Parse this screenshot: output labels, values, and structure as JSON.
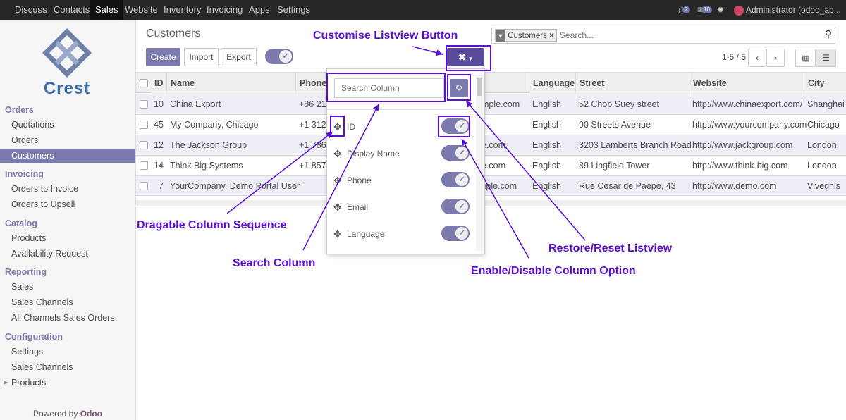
{
  "topnav": {
    "items": [
      "Discuss",
      "Contacts",
      "Sales",
      "Website",
      "Inventory",
      "Invoicing",
      "Apps",
      "Settings"
    ],
    "active": "Sales",
    "chat_badge": "2",
    "msg_badge": "10",
    "user": "Administrator (odoo_ap..."
  },
  "sidebar": {
    "logo_text": "Crest",
    "sections": [
      {
        "title": "Orders",
        "items": [
          "Quotations",
          "Orders",
          "Customers"
        ]
      },
      {
        "title": "Invoicing",
        "items": [
          "Orders to Invoice",
          "Orders to Upsell"
        ]
      },
      {
        "title": "Catalog",
        "items": [
          "Products",
          "Availability Request"
        ]
      },
      {
        "title": "Reporting",
        "items": [
          "Sales",
          "Sales Channels",
          "All Channels Sales Orders"
        ]
      },
      {
        "title": "Configuration",
        "items": [
          "Settings",
          "Sales Channels",
          "Products"
        ]
      }
    ],
    "active_item": "Customers",
    "powered_by": "Powered by",
    "powered_brand": "Odoo"
  },
  "main": {
    "breadcrumb": "Customers",
    "buttons": {
      "create": "Create",
      "import": "Import",
      "export": "Export"
    },
    "search": {
      "facet": "Customers",
      "placeholder": "Search..."
    },
    "pager": "1-5 / 5",
    "columns": [
      "ID",
      "Name",
      "Phone",
      "Language",
      "Street",
      "Website",
      "City"
    ],
    "rows": [
      {
        "id": "10",
        "name": "China Export",
        "phone": "+86 21",
        "email_part": "mple.com",
        "lang": "English",
        "street": "52 Chop Suey street",
        "website": "http://www.chinaexport.com/",
        "city": "Shanghai"
      },
      {
        "id": "45",
        "name": "My Company, Chicago",
        "phone": "+1 312",
        "email_part": "",
        "lang": "English",
        "street": "90 Streets Avenue",
        "website": "http://www.yourcompany.com",
        "city": "Chicago"
      },
      {
        "id": "12",
        "name": "The Jackson Group",
        "phone": "+1 786",
        "email_part": "e.com",
        "lang": "English",
        "street": "3203 Lamberts Branch Road",
        "website": "http://www.jackgroup.com",
        "city": "London"
      },
      {
        "id": "14",
        "name": "Think Big Systems",
        "phone": "+1 857",
        "email_part": "e.com",
        "lang": "English",
        "street": "89 Lingfield Tower",
        "website": "http://www.think-big.com",
        "city": "London"
      },
      {
        "id": "7",
        "name": "YourCompany, Demo Portal User",
        "phone": "",
        "email_part": "mple.com",
        "lang": "English",
        "street": "Rue Cesar de Paepe, 43",
        "website": "http://www.demo.com",
        "city": "Vivegnis"
      }
    ]
  },
  "dropdown": {
    "search_placeholder": "Search Column",
    "columns": [
      "ID",
      "Display Name",
      "Phone",
      "Email",
      "Language"
    ]
  },
  "annotations": {
    "customise": "Customise Listview Button",
    "dragable": "Dragable Column Sequence",
    "search": "Search Column",
    "restore": "Restore/Reset Listview",
    "enable": "Enable/Disable Column Option"
  },
  "colors": {
    "accent": "#7c7bad",
    "annotation": "#5b0fd6",
    "topbar": "#272727"
  }
}
